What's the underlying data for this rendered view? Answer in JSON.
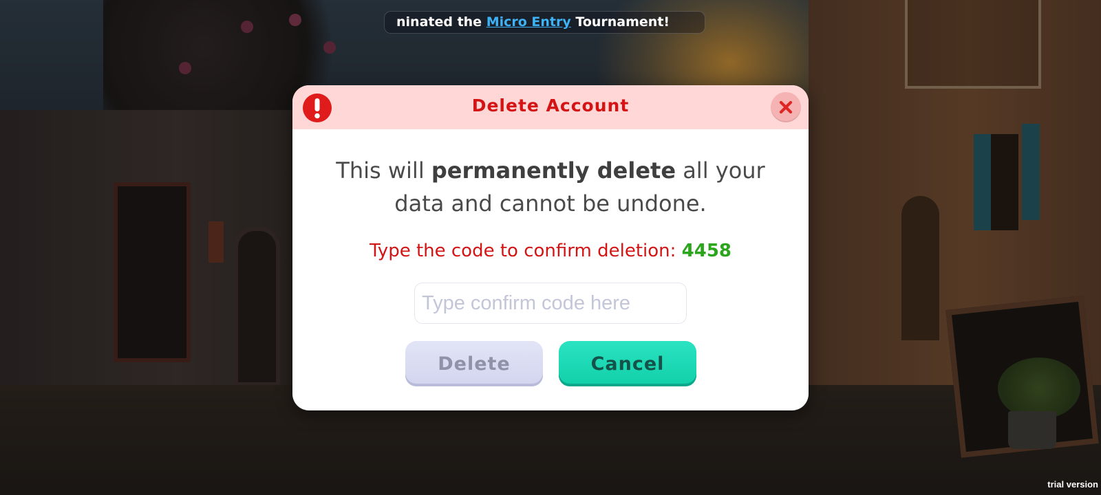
{
  "ticker": {
    "prefix": "ninated the ",
    "link": "Micro Entry",
    "suffix": " Tournament!"
  },
  "dialog": {
    "title": "Delete Account",
    "icons": {
      "alert": "exclamation-circle-icon",
      "close": "close-icon"
    },
    "message": {
      "part1": "This will ",
      "bold": "permanently delete",
      "part2": " all your data and cannot be undone."
    },
    "confirm_prompt": "Type the code to confirm deletion: ",
    "confirm_code": "4458",
    "input": {
      "placeholder": "Type confirm code here",
      "value": ""
    },
    "delete_label": "Delete",
    "cancel_label": "Cancel"
  },
  "colors": {
    "header_bg": "#ffd7d7",
    "title_red": "#d41414",
    "code_green": "#2aa51c",
    "cancel_teal": "#10cfa8",
    "delete_disabled": "#d2d5ee"
  },
  "watermark": "trial version"
}
